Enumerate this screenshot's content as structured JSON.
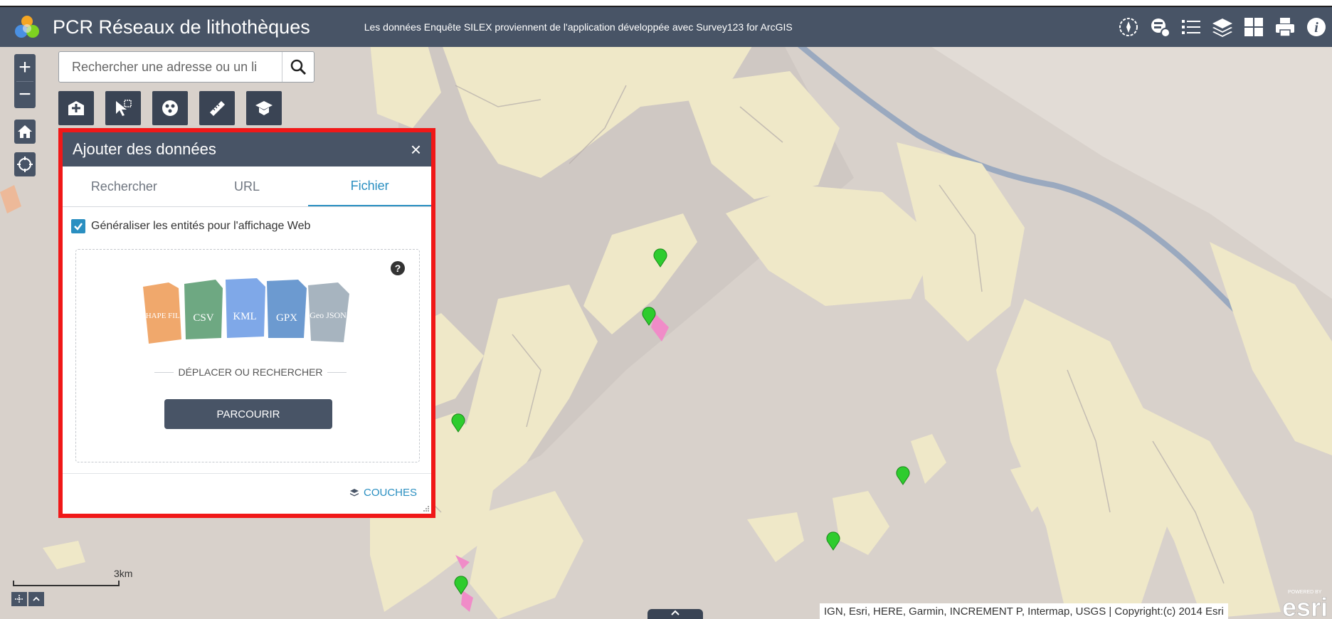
{
  "header": {
    "title": "PCR Réseaux de lithothèques",
    "subtitle": "Les données Enquête SILEX proviennent de l'application développée avec Survey123 for ArcGIS",
    "icons": [
      "compass-icon",
      "coverage-icon",
      "legend-list-icon",
      "layers-icon",
      "basemap-grid-icon",
      "print-icon",
      "info-icon"
    ]
  },
  "map_controls": {
    "zoom_in": "+",
    "zoom_out": "−"
  },
  "search": {
    "placeholder": "Rechercher une adresse ou un li"
  },
  "toolbar": {
    "tools": [
      "add-data-icon",
      "select-icon",
      "analysis-icon",
      "measure-icon",
      "education-icon"
    ]
  },
  "panel": {
    "title": "Ajouter des données",
    "close": "×",
    "tabs": [
      "Rechercher",
      "URL",
      "Fichier"
    ],
    "active_tab": "Fichier",
    "generalize_label": "Généraliser les entités pour l'affichage Web",
    "generalize_checked": true,
    "help": "?",
    "file_types": [
      "SHAPE FILE",
      "CSV",
      "KML",
      "GPX",
      "Geo JSON"
    ],
    "dropzone_text": "DÉPLACER OU RECHERCHER",
    "browse_label": "PARCOURIR",
    "layers_label": "COUCHES"
  },
  "scalebar": {
    "label": "3km"
  },
  "attribution": "IGN, Esri, HERE, Garmin, INCREMENT P, Intermap, USGS | Copyright:(c) 2014 Esri",
  "esri_logo": {
    "powered_by": "POWERED BY",
    "brand": "esri"
  },
  "colors": {
    "header": "#485466",
    "highlight_border": "#f01818",
    "accent": "#2a8fc1",
    "pin": "#2ecc2e",
    "map_base": "#d9d2cc",
    "map_sediment": "#efe8c8"
  }
}
